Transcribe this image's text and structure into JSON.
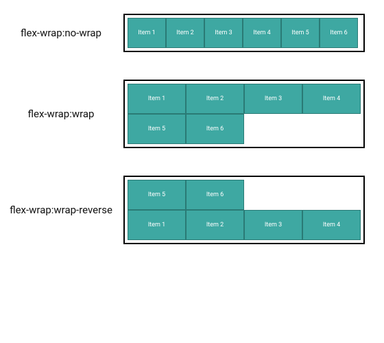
{
  "examples": [
    {
      "label": "flex-wrap:no-wrap",
      "wrap_class": "nowrap",
      "items": [
        "Item 1",
        "Item 2",
        "Item 3",
        "Item 4",
        "Item 5",
        "Item 6"
      ]
    },
    {
      "label": "flex-wrap:wrap",
      "wrap_class": "wrap",
      "items": [
        "Item 1",
        "Item 2",
        "Item 3",
        "Item 4",
        "Item 5",
        "Item 6"
      ]
    },
    {
      "label": "flex-wrap:wrap-reverse",
      "wrap_class": "wrap-reverse",
      "items": [
        "Item 1",
        "Item 2",
        "Item 3",
        "Item 4",
        "Item 5",
        "Item 6"
      ]
    }
  ]
}
